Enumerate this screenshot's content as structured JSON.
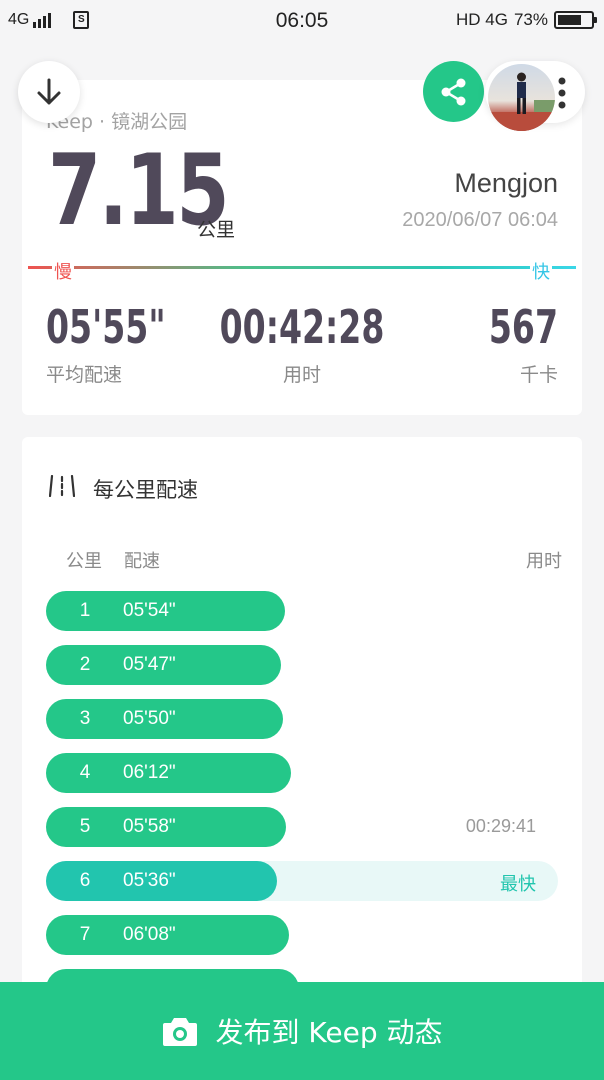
{
  "status_bar": {
    "network_left": "4G",
    "time": "06:05",
    "network_right": "HD 4G",
    "battery_percent": "73%",
    "battery_level": 0.73
  },
  "summary": {
    "source": "Keep · 镜湖公园",
    "distance": "7.15",
    "distance_unit": "公里",
    "username": "Mengjon",
    "datetime": "2020/06/07 06:04",
    "pace_slow_label": "慢",
    "pace_fast_label": "快",
    "stats": {
      "avg_pace": {
        "value": "05'55\"",
        "label": "平均配速"
      },
      "duration": {
        "value": "00:42:28",
        "label": "用时"
      },
      "calories": {
        "value": "567",
        "label": "千卡"
      }
    }
  },
  "splits": {
    "title": "每公里配速",
    "headers": {
      "km": "公里",
      "pace": "配速",
      "time": "用时"
    },
    "rows": [
      {
        "km": "1",
        "pace": "05'54\"",
        "bar_fraction": 0.466,
        "note": "",
        "fastest": false
      },
      {
        "km": "2",
        "pace": "05'47\"",
        "bar_fraction": 0.459,
        "note": "",
        "fastest": false
      },
      {
        "km": "3",
        "pace": "05'50\"",
        "bar_fraction": 0.463,
        "note": "",
        "fastest": false
      },
      {
        "km": "4",
        "pace": "06'12\"",
        "bar_fraction": 0.479,
        "note": "",
        "fastest": false
      },
      {
        "km": "5",
        "pace": "05'58\"",
        "bar_fraction": 0.469,
        "note": "00:29:41",
        "fastest": false
      },
      {
        "km": "6",
        "pace": "05'36\"",
        "bar_fraction": 0.451,
        "note": "最快",
        "fastest": true
      },
      {
        "km": "7",
        "pace": "06'08\"",
        "bar_fraction": 0.475,
        "note": "",
        "fastest": false
      },
      {
        "km": "",
        "pace": "",
        "bar_fraction": 0.494,
        "note": "",
        "fastest": false
      }
    ]
  },
  "publish_button": {
    "label": "发布到 Keep 动态"
  },
  "icons": {
    "down": "arrow-down-icon",
    "share": "share-icon",
    "more": "more-vertical-icon",
    "splits": "splits-icon",
    "camera": "camera-icon"
  },
  "colors": {
    "brand_green": "#24c789",
    "fastest_teal": "#22c5ae",
    "slow_red": "#ef5350",
    "fast_cyan": "#35c6e6"
  }
}
